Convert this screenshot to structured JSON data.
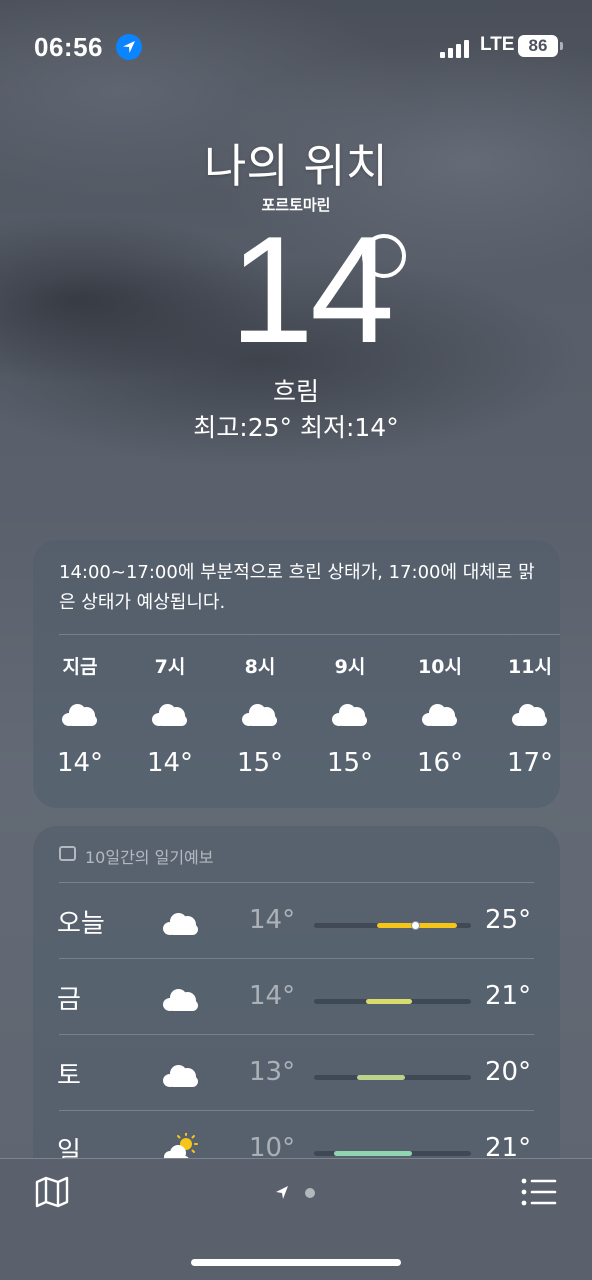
{
  "status": {
    "time": "06:56",
    "network": "LTE",
    "battery": "86"
  },
  "header": {
    "title": "나의 위치",
    "subtitle": "포르토마린",
    "temperature": "14",
    "condition": "흐림",
    "hilo": "최고:25°  최저:14°"
  },
  "hourly": {
    "summary": "14:00~17:00에 부분적으로 흐린 상태가, 17:00에 대체로 맑은 상태가 예상됩니다.",
    "items": [
      {
        "label": "지금",
        "icon": "cloud-icon",
        "temp": "14°"
      },
      {
        "label": "7시",
        "icon": "cloud-icon",
        "temp": "14°"
      },
      {
        "label": "8시",
        "icon": "cloud-icon",
        "temp": "15°"
      },
      {
        "label": "9시",
        "icon": "cloud-icon",
        "temp": "15°"
      },
      {
        "label": "10시",
        "icon": "cloud-icon",
        "temp": "16°"
      },
      {
        "label": "11시",
        "icon": "cloud-icon",
        "temp": "17°"
      }
    ]
  },
  "tenday": {
    "header": "10일간의 일기예보",
    "range": [
      10,
      25
    ],
    "days": [
      {
        "name": "오늘",
        "icon": "cloud-icon",
        "low": "14°",
        "high": "25°",
        "low_val": 14,
        "high_val": 25,
        "current_val": 14,
        "color": "#f5c518"
      },
      {
        "name": "금",
        "icon": "cloud-icon",
        "low": "14°",
        "high": "21°",
        "low_val": 14,
        "high_val": 21,
        "color": "#d9dc6a"
      },
      {
        "name": "토",
        "icon": "cloud-icon",
        "low": "13°",
        "high": "20°",
        "low_val": 13,
        "high_val": 20,
        "color": "#bcd38a"
      },
      {
        "name": "일",
        "icon": "partly-sunny-icon",
        "low": "10°",
        "high": "21°",
        "low_val": 10,
        "high_val": 21,
        "color": "#8fd6b0"
      }
    ]
  },
  "colors": {
    "accent": "#0a84ff",
    "sun": "#f5c518"
  }
}
